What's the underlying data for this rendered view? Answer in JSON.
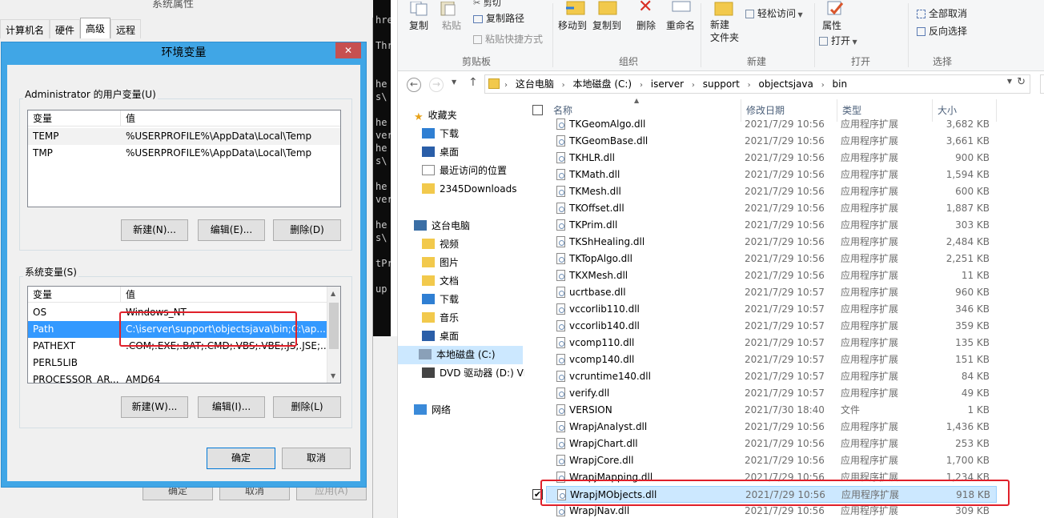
{
  "sysprops": {
    "title": "系统属性",
    "tabs": [
      "计算机名",
      "硬件",
      "高级",
      "远程"
    ],
    "bottom_buttons": [
      "确定",
      "取消",
      "应用(A)"
    ]
  },
  "envdlg": {
    "title": "环境变量",
    "close": "✕",
    "user_group_label": "Administrator 的用户变量(U)",
    "columns": [
      "变量",
      "值"
    ],
    "user_vars": [
      {
        "name": "TEMP",
        "value": "%USERPROFILE%\\AppData\\Local\\Temp"
      },
      {
        "name": "TMP",
        "value": "%USERPROFILE%\\AppData\\Local\\Temp"
      }
    ],
    "user_buttons": [
      "新建(N)...",
      "编辑(E)...",
      "删除(D)"
    ],
    "system_group_label": "系统变量(S)",
    "system_vars": [
      {
        "name": "OS",
        "value": "Windows_NT"
      },
      {
        "name": "Path",
        "value": "C:\\iserver\\support\\objectsjava\\bin;C:\\ap..."
      },
      {
        "name": "PATHEXT",
        "value": ".COM;.EXE;.BAT;.CMD;.VBS;.VBE;.JS;.JSE;..."
      },
      {
        "name": "PERL5LIB",
        "value": ""
      },
      {
        "name": "PROCESSOR_AR...",
        "value": "AMD64"
      }
    ],
    "system_buttons": [
      "新建(W)...",
      "编辑(I)...",
      "删除(L)"
    ],
    "ok": "确定",
    "cancel": "取消"
  },
  "console": {
    "lines": [
      "hre",
      "Thr",
      "he",
      "s\\",
      "he",
      "ver",
      "he",
      "s\\",
      "he",
      "ver",
      "he",
      "s\\",
      "tPr",
      "up"
    ]
  },
  "ribbon": {
    "copy": "复制",
    "paste": "粘贴",
    "copy_path": "复制路径",
    "paste_shortcut": "粘贴快捷方式",
    "cut": "剪切",
    "clipboard_group": "剪贴板",
    "move_to": "移动到",
    "copy_to": "复制到",
    "delete": "删除",
    "rename": "重命名",
    "organize_group": "组织",
    "new_folder": "新建\n文件夹",
    "easy_access": "轻松访问",
    "new_group": "新建",
    "properties": "属性",
    "open": "打开",
    "open_group": "打开",
    "select_none": "全部取消",
    "invert_selection": "反向选择",
    "select_group": "选择"
  },
  "address": {
    "crumbs": [
      "这台电脑",
      "本地磁盘 (C:)",
      "iserver",
      "support",
      "objectsjava",
      "bin"
    ]
  },
  "nav": {
    "quick_access": "收藏夹",
    "items_fav": [
      "下载",
      "桌面",
      "最近访问的位置",
      "2345Downloads"
    ],
    "this_pc": "这台电脑",
    "items_pc": [
      "视频",
      "图片",
      "文档",
      "下载",
      "音乐",
      "桌面",
      "本地磁盘 (C:)",
      "DVD 驱动器 (D:) VM"
    ],
    "network": "网络"
  },
  "files": {
    "columns": [
      "名称",
      "修改日期",
      "类型",
      "大小"
    ],
    "rows": [
      {
        "name": "TKGeomAlgo.dll",
        "date": "2021/7/29 10:56",
        "type": "应用程序扩展",
        "size": "3,682 KB"
      },
      {
        "name": "TKGeomBase.dll",
        "date": "2021/7/29 10:56",
        "type": "应用程序扩展",
        "size": "3,661 KB"
      },
      {
        "name": "TKHLR.dll",
        "date": "2021/7/29 10:56",
        "type": "应用程序扩展",
        "size": "900 KB"
      },
      {
        "name": "TKMath.dll",
        "date": "2021/7/29 10:56",
        "type": "应用程序扩展",
        "size": "1,594 KB"
      },
      {
        "name": "TKMesh.dll",
        "date": "2021/7/29 10:56",
        "type": "应用程序扩展",
        "size": "600 KB"
      },
      {
        "name": "TKOffset.dll",
        "date": "2021/7/29 10:56",
        "type": "应用程序扩展",
        "size": "1,887 KB"
      },
      {
        "name": "TKPrim.dll",
        "date": "2021/7/29 10:56",
        "type": "应用程序扩展",
        "size": "303 KB"
      },
      {
        "name": "TKShHealing.dll",
        "date": "2021/7/29 10:56",
        "type": "应用程序扩展",
        "size": "2,484 KB"
      },
      {
        "name": "TKTopAlgo.dll",
        "date": "2021/7/29 10:56",
        "type": "应用程序扩展",
        "size": "2,251 KB"
      },
      {
        "name": "TKXMesh.dll",
        "date": "2021/7/29 10:56",
        "type": "应用程序扩展",
        "size": "11 KB"
      },
      {
        "name": "ucrtbase.dll",
        "date": "2021/7/29 10:57",
        "type": "应用程序扩展",
        "size": "960 KB"
      },
      {
        "name": "vccorlib110.dll",
        "date": "2021/7/29 10:57",
        "type": "应用程序扩展",
        "size": "346 KB"
      },
      {
        "name": "vccorlib140.dll",
        "date": "2021/7/29 10:57",
        "type": "应用程序扩展",
        "size": "359 KB"
      },
      {
        "name": "vcomp110.dll",
        "date": "2021/7/29 10:57",
        "type": "应用程序扩展",
        "size": "135 KB"
      },
      {
        "name": "vcomp140.dll",
        "date": "2021/7/29 10:57",
        "type": "应用程序扩展",
        "size": "151 KB"
      },
      {
        "name": "vcruntime140.dll",
        "date": "2021/7/29 10:57",
        "type": "应用程序扩展",
        "size": "84 KB"
      },
      {
        "name": "verify.dll",
        "date": "2021/7/29 10:57",
        "type": "应用程序扩展",
        "size": "49 KB"
      },
      {
        "name": "VERSION",
        "date": "2021/7/30 18:40",
        "type": "文件",
        "size": "1 KB"
      },
      {
        "name": "WrapjAnalyst.dll",
        "date": "2021/7/29 10:56",
        "type": "应用程序扩展",
        "size": "1,436 KB"
      },
      {
        "name": "WrapjChart.dll",
        "date": "2021/7/29 10:56",
        "type": "应用程序扩展",
        "size": "253 KB"
      },
      {
        "name": "WrapjCore.dll",
        "date": "2021/7/29 10:56",
        "type": "应用程序扩展",
        "size": "1,700 KB"
      },
      {
        "name": "WrapjMapping.dll",
        "date": "2021/7/29 10:56",
        "type": "应用程序扩展",
        "size": "1,234 KB"
      },
      {
        "name": "WrapjMObjects.dll",
        "date": "2021/7/29 10:56",
        "type": "应用程序扩展",
        "size": "918 KB",
        "selected": true
      },
      {
        "name": "WrapjNav.dll",
        "date": "2021/7/29 10:56",
        "type": "应用程序扩展",
        "size": "309 KB"
      }
    ]
  },
  "colors": {
    "highlight": "#e0202a",
    "selection": "#3399ff",
    "explorer_selection": "#cce8ff",
    "title_blue": "#40a6e6"
  }
}
